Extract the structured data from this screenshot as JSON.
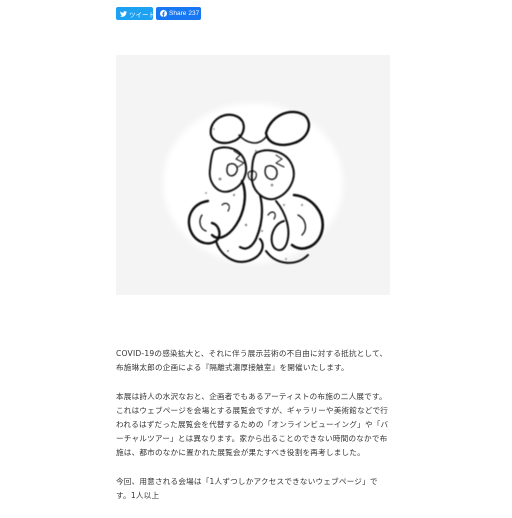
{
  "share": {
    "tweet_label": "ツイート",
    "facebook_label": "Share",
    "facebook_count": "237"
  },
  "colors": {
    "twitter": "#1da1f2",
    "facebook": "#1877f2",
    "text": "#333333",
    "image_bg": "#f4f4f4"
  },
  "article": {
    "paragraphs": [
      "COVID-19の感染拡大と、それに伴う展示芸術の不自由に対する抵抗として、布施琳太郎の企画による『隔離式濃厚接触室』を開催いたします。",
      "本展は詩人の水沢なおと、企画者でもあるアーティストの布施の二人展です。これはウェブページを会場とする展覧会ですが、ギャラリーや美術館などで行われるはずだった展覧会を代替するための「オンラインビューイング」や「バーチャルツアー」とは異なります。家から出ることのできない時間のなかで布施は、都市のなかに置かれた展覧会が果たすべき役割を再考しました。",
      "今回、用意される会場は「1人ずつしかアクセスできないウェブページ」です。1人以上"
    ]
  }
}
